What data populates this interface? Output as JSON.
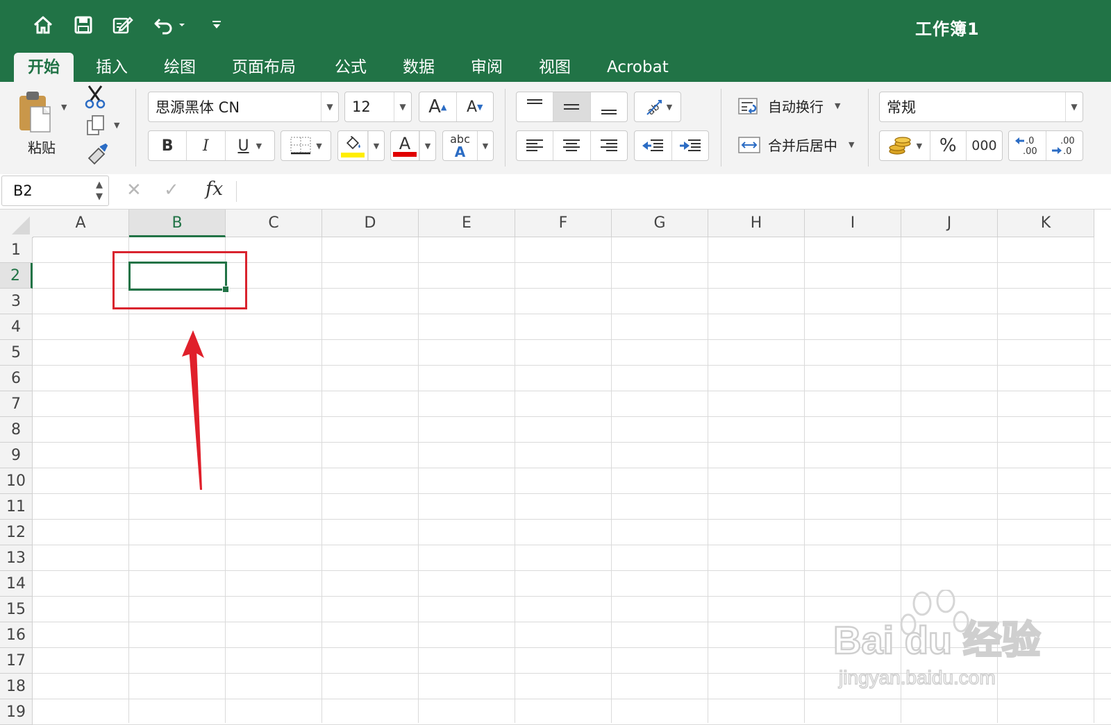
{
  "quick_access": {
    "icons": [
      "home-icon",
      "save-icon",
      "edit-document-icon",
      "undo-icon",
      "customize-icon"
    ]
  },
  "window": {
    "title": "工作簿1"
  },
  "tabs": [
    {
      "label": "开始",
      "active": true
    },
    {
      "label": "插入"
    },
    {
      "label": "绘图"
    },
    {
      "label": "页面布局"
    },
    {
      "label": "公式"
    },
    {
      "label": "数据"
    },
    {
      "label": "审阅"
    },
    {
      "label": "视图"
    },
    {
      "label": "Acrobat"
    }
  ],
  "ribbon": {
    "paste_label": "粘贴",
    "font_name": "思源黑体 CN",
    "font_size": "12",
    "bold": "B",
    "italic": "I",
    "underline": "U",
    "wrap_text": "自动换行",
    "merge_center": "合并后居中",
    "number_format": "常规",
    "percent": "%",
    "thousands": "000",
    "fill_color": "#ffee00",
    "font_color": "#e00000"
  },
  "formula_bar": {
    "cell_ref": "B2",
    "fx": "fx",
    "content": ""
  },
  "grid": {
    "columns": [
      "A",
      "B",
      "C",
      "D",
      "E",
      "F",
      "G",
      "H",
      "I",
      "J",
      "K"
    ],
    "rows": [
      "1",
      "2",
      "3",
      "4",
      "5",
      "6",
      "7",
      "8",
      "9",
      "10",
      "11",
      "12",
      "13",
      "14",
      "15",
      "16",
      "17",
      "18",
      "19"
    ],
    "selected_column": "B",
    "selected_row": "2"
  },
  "watermark": {
    "brand": "Bai du 经验",
    "url": "jingyan.baidu.com"
  },
  "colors": {
    "accent": "#217346",
    "annotation": "#d9232e"
  }
}
